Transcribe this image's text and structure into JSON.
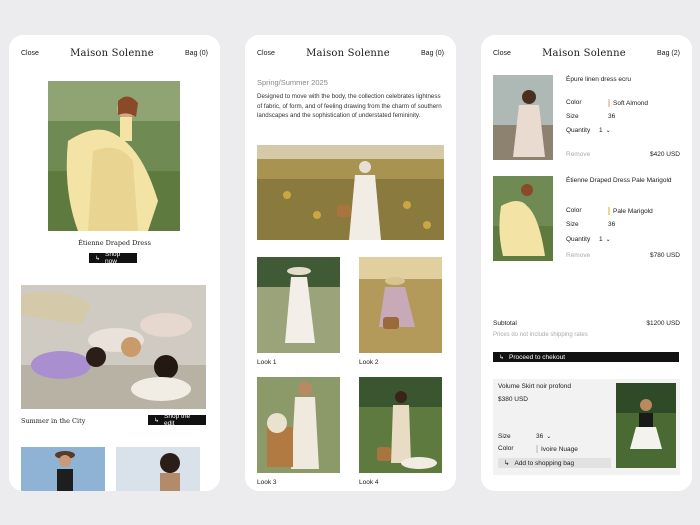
{
  "header": {
    "close": "Close",
    "brand": "Maison Solenne",
    "bag_empty": "Bag (0)",
    "bag_full": "Bag (2)"
  },
  "screen1": {
    "hero_caption": "Étienne Draped Dress",
    "shop_now": "Shop now",
    "group_caption": "Summer in the City",
    "shop_edit": "Shop the edit"
  },
  "screen2": {
    "season": "Spring/Summer 2025",
    "description": "Designed to move with the body, the collection celebrates lightness of fabric, of form, and of feeling drawing from the charm of southern landscapes and the sophistication of understated femininity.",
    "looks": [
      "Look 1",
      "Look 2",
      "Look 3",
      "Look 4"
    ]
  },
  "screen3": {
    "items": [
      {
        "name": "Épure linen dress ecru",
        "color_label": "Color",
        "color": "Soft Almond",
        "swatch": "#e8cfc0",
        "size_label": "Size",
        "size": "36",
        "qty_label": "Quantity",
        "qty": "1",
        "remove": "Remove",
        "price": "$420 USD"
      },
      {
        "name": "Étienne Draped Dress Pale Marigold",
        "color_label": "Color",
        "color": "Pale Marigold",
        "swatch": "#f0d48a",
        "size_label": "Size",
        "size": "36",
        "qty_label": "Quantity",
        "qty": "1",
        "remove": "Remove",
        "price": "$780 USD"
      }
    ],
    "subtotal_label": "Subtotal",
    "subtotal": "$1200 USD",
    "shipping_note": "Prices do not include shipping rates",
    "checkout": "Proceed to chekout",
    "upsell": {
      "name": "Volume Skirt noir profond",
      "price": "$380 USD",
      "size_label": "Size",
      "size": "36",
      "color_label": "Color",
      "color": "Ivoire Nuage",
      "add": "Add to shopping bag"
    }
  },
  "colors": {
    "accent": "#111111",
    "background": "#ecebee",
    "card": "#ffffff"
  }
}
